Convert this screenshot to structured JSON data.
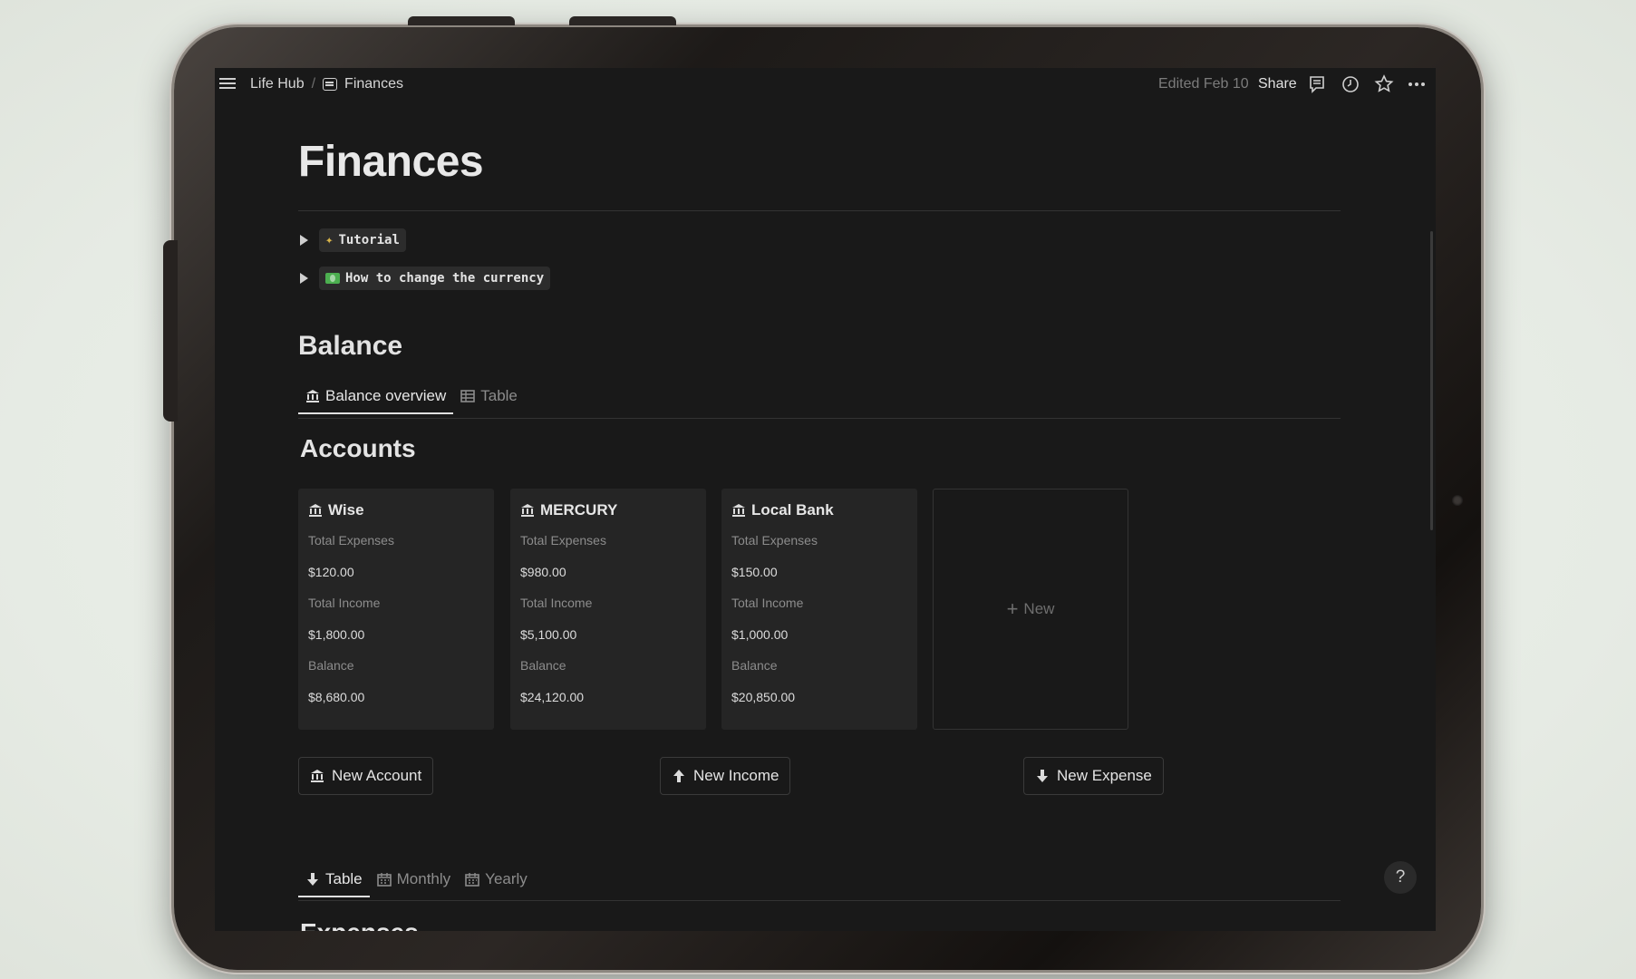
{
  "breadcrumb": {
    "workspace": "Life Hub",
    "page": "Finances"
  },
  "topbar": {
    "edited": "Edited Feb 10",
    "share": "Share"
  },
  "page": {
    "title": "Finances"
  },
  "toggles": [
    {
      "label": "Tutorial",
      "icon": "magic-wand-icon"
    },
    {
      "label": "How to change the currency",
      "icon": "money-icon"
    }
  ],
  "balance": {
    "heading": "Balance",
    "tabs": [
      {
        "label": "Balance overview",
        "icon": "bank-icon"
      },
      {
        "label": "Table",
        "icon": "table-icon"
      }
    ],
    "accounts_heading": "Accounts",
    "accounts": [
      {
        "name": "Wise",
        "total_expenses_label": "Total Expenses",
        "total_expenses": "$120.00",
        "total_income_label": "Total Income",
        "total_income": "$1,800.00",
        "balance_label": "Balance",
        "balance": "$8,680.00"
      },
      {
        "name": "MERCURY",
        "total_expenses_label": "Total Expenses",
        "total_expenses": "$980.00",
        "total_income_label": "Total Income",
        "total_income": "$5,100.00",
        "balance_label": "Balance",
        "balance": "$24,120.00"
      },
      {
        "name": "Local Bank",
        "total_expenses_label": "Total Expenses",
        "total_expenses": "$150.00",
        "total_income_label": "Total Income",
        "total_income": "$1,000.00",
        "balance_label": "Balance",
        "balance": "$20,850.00"
      }
    ],
    "new_card": "New"
  },
  "actions": {
    "new_account": "New Account",
    "new_income": "New Income",
    "new_expense": "New Expense"
  },
  "expenses": {
    "tabs": [
      {
        "label": "Table",
        "icon": "arrow-down-icon"
      },
      {
        "label": "Monthly",
        "icon": "calendar-icon"
      },
      {
        "label": "Yearly",
        "icon": "calendar-icon"
      }
    ],
    "heading": "Expenses"
  },
  "help": "?"
}
